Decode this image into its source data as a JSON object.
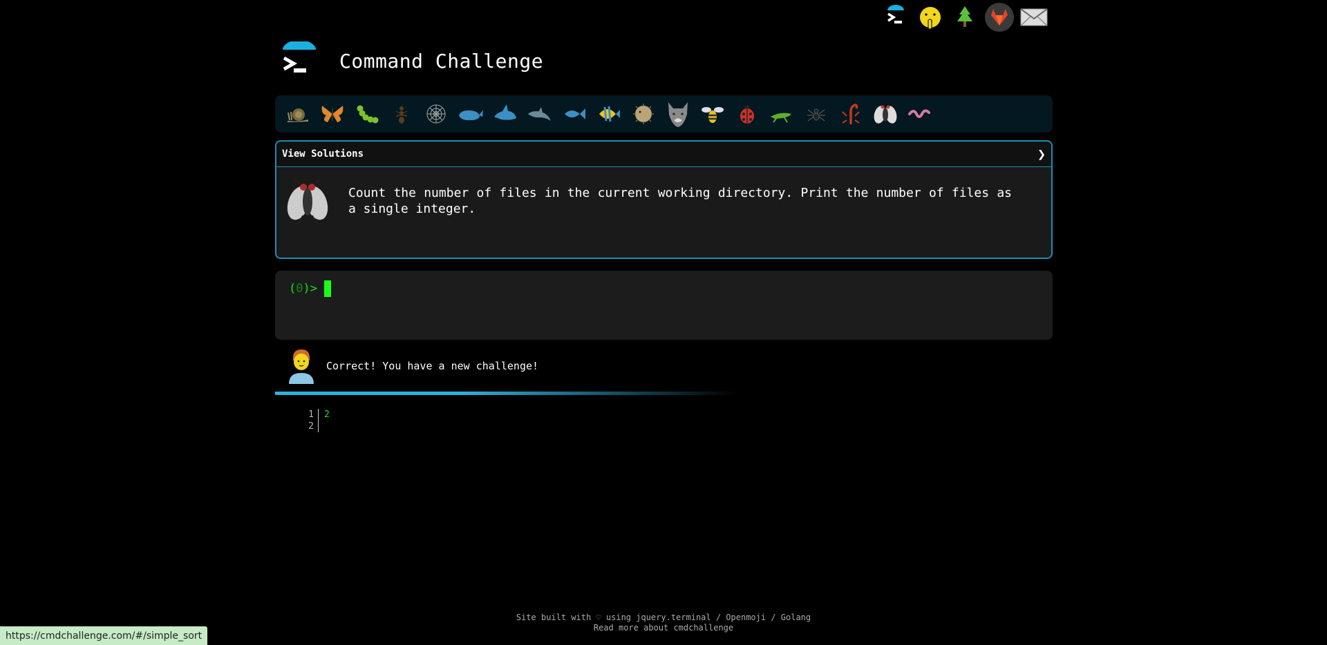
{
  "header": {
    "title": "Command Challenge"
  },
  "top_icons": [
    "terminal-icon",
    "shush-face-icon",
    "tree-icon",
    "gitlab-icon",
    "mail-icon"
  ],
  "creatures": [
    "snail-icon",
    "butterfly-icon",
    "caterpillar-icon",
    "ant-icon",
    "spider-web-icon",
    "whale-icon",
    "shark-icon",
    "dolphin-icon",
    "fish-icon",
    "tropical-fish-icon",
    "blowfish-icon",
    "wolf-icon",
    "bee-icon",
    "ladybug-icon",
    "cricket-icon",
    "spider-icon",
    "scorpion-icon",
    "fly-icon",
    "worm-icon"
  ],
  "challenge": {
    "head_label": "View Solutions",
    "chevron": "❯",
    "text": "Count the number of files in the current working directory. Print the number of files as a single integer."
  },
  "terminal": {
    "prompt_open": "(",
    "prompt_num": "0",
    "prompt_close": ")>"
  },
  "message": {
    "text": "Correct! You have a new challenge!"
  },
  "editor": {
    "lines": [
      {
        "num": "1",
        "code": "2"
      },
      {
        "num": "2",
        "code": ""
      }
    ]
  },
  "footer": {
    "line1": "Site built with ♡ using jquery.terminal / Openmoji / Golang",
    "line2": "Read more about cmdchallenge"
  },
  "status_url": "https://cmdchallenge.com/#/simple_sort",
  "colors": {
    "accent": "#1a8fb5",
    "prompt_green": "#19e619",
    "progress": "#2cb3e0"
  }
}
